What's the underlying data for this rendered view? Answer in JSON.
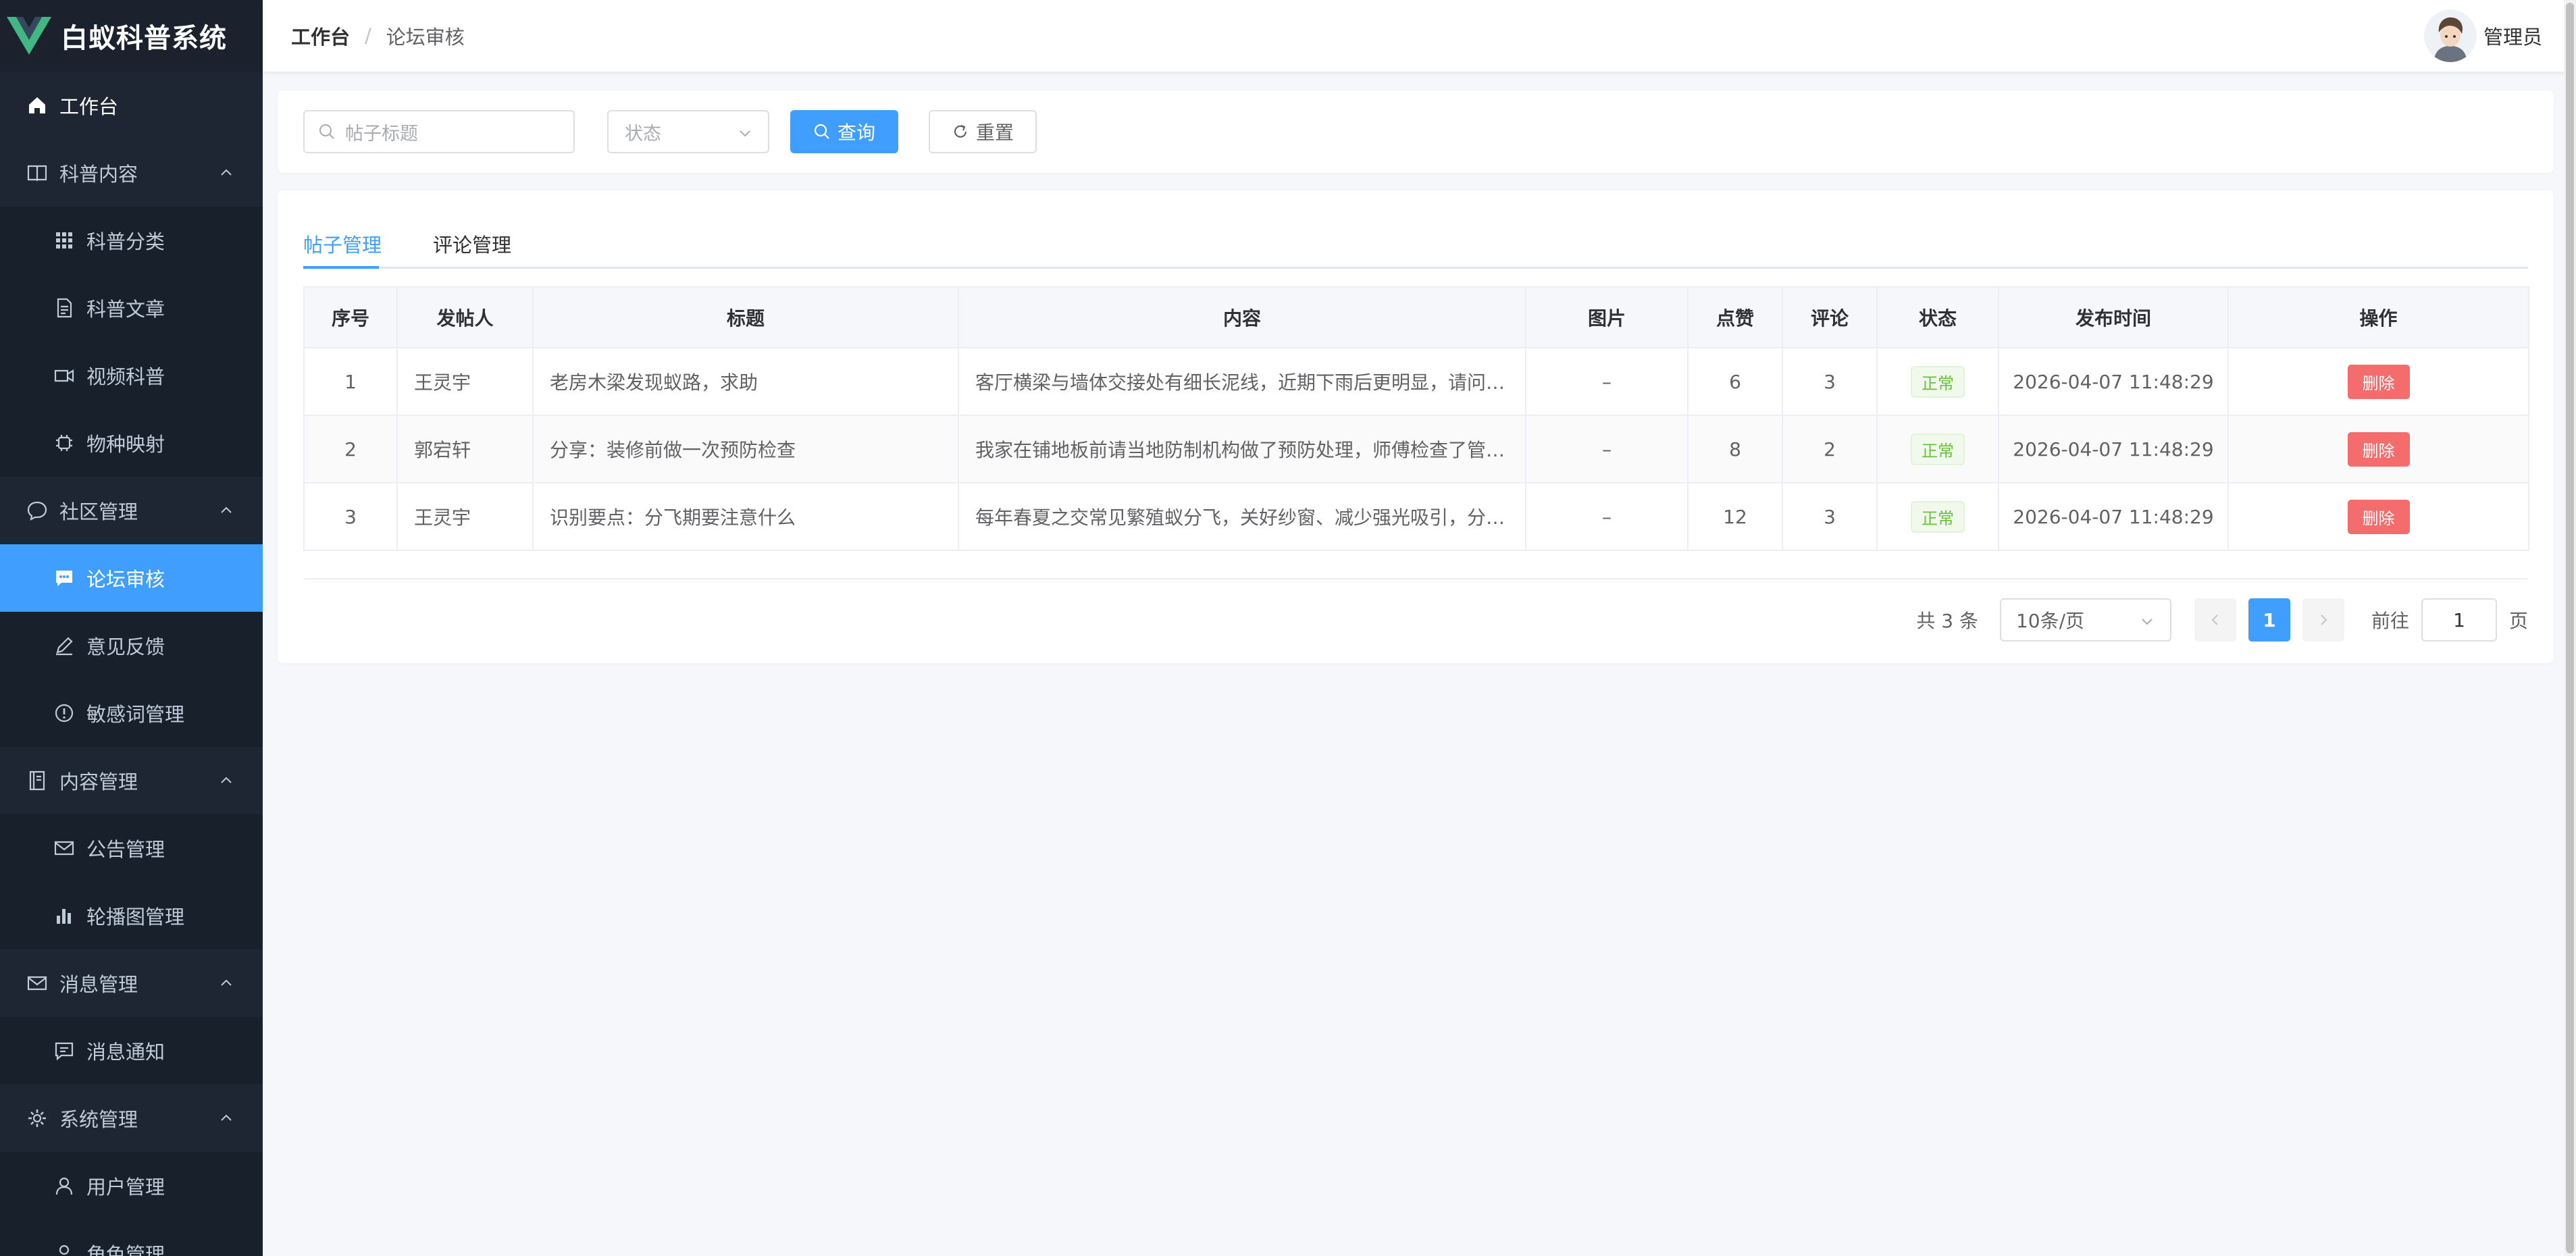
{
  "app": {
    "title": "白蚁科普系统"
  },
  "sidebar": {
    "items": [
      {
        "label": "工作台"
      },
      {
        "label": "科普内容"
      },
      {
        "label": "科普分类"
      },
      {
        "label": "科普文章"
      },
      {
        "label": "视频科普"
      },
      {
        "label": "物种映射"
      },
      {
        "label": "社区管理"
      },
      {
        "label": "论坛审核"
      },
      {
        "label": "意见反馈"
      },
      {
        "label": "敏感词管理"
      },
      {
        "label": "内容管理"
      },
      {
        "label": "公告管理"
      },
      {
        "label": "轮播图管理"
      },
      {
        "label": "消息管理"
      },
      {
        "label": "消息通知"
      },
      {
        "label": "系统管理"
      },
      {
        "label": "用户管理"
      },
      {
        "label": "角色管理"
      }
    ],
    "active_color": "#409eff",
    "bg_color": "#1f2633"
  },
  "header": {
    "breadcrumb": {
      "home": "工作台",
      "sep": "/",
      "current": "论坛审核"
    },
    "user_name": "管理员"
  },
  "search": {
    "title_placeholder": "帖子标题",
    "status_placeholder": "状态",
    "query_label": "查询",
    "reset_label": "重置"
  },
  "tabs": [
    {
      "label": "帖子管理",
      "active": true
    },
    {
      "label": "评论管理",
      "active": false
    }
  ],
  "table": {
    "columns": [
      "序号",
      "发帖人",
      "标题",
      "内容",
      "图片",
      "点赞",
      "评论",
      "状态",
      "发布时间",
      "操作"
    ],
    "rows": [
      {
        "idx": "1",
        "author": "王灵宇",
        "title": "老房木梁发现蚁路，求助",
        "content": "客厅横梁与墙体交接处有细长泥线，近期下雨后更明显，请问…",
        "image": "–",
        "likes": "6",
        "comments": "3",
        "status": "正常",
        "time": "2026-04-07 11:48:29",
        "action": "删除"
      },
      {
        "idx": "2",
        "author": "郭宕轩",
        "title": "分享：装修前做一次预防检查",
        "content": "我家在铺地板前请当地防制机构做了预防处理，师傅检查了管…",
        "image": "–",
        "likes": "8",
        "comments": "2",
        "status": "正常",
        "time": "2026-04-07 11:48:29",
        "action": "删除"
      },
      {
        "idx": "3",
        "author": "王灵宇",
        "title": "识别要点：分飞期要注意什么",
        "content": "每年春夏之交常见繁殖蚁分飞，关好纱窗、减少强光吸引，分…",
        "image": "–",
        "likes": "12",
        "comments": "3",
        "status": "正常",
        "time": "2026-04-07 11:48:29",
        "action": "删除"
      }
    ]
  },
  "pagination": {
    "total": "共 3 条",
    "page_size": "10条/页",
    "current_page": "1",
    "goto_label": "前往",
    "goto_value": "1",
    "page_suffix": "页"
  }
}
